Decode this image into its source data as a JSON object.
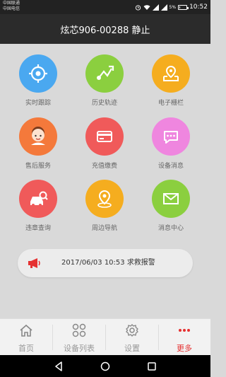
{
  "status_bar": {
    "carrier1": "中国联通",
    "carrier2": "中国电信",
    "battery_percent": "5%",
    "battery_level": 0.05,
    "time": "10:52"
  },
  "header": {
    "title": "炫芯906-00288 静止"
  },
  "tiles": [
    {
      "label": "实时跟踪",
      "icon": "realtime-tracking-icon",
      "color": "#4aa8f0"
    },
    {
      "label": "历史轨迹",
      "icon": "history-track-icon",
      "color": "#8bcf3f"
    },
    {
      "label": "电子栅栏",
      "icon": "geofence-icon",
      "color": "#f5ad1f"
    },
    {
      "label": "售后服务",
      "icon": "customer-service-icon",
      "color": "#f4793b"
    },
    {
      "label": "充值缴费",
      "icon": "recharge-card-icon",
      "color": "#f05a5a"
    },
    {
      "label": "设备消息",
      "icon": "chat-bubble-icon",
      "color": "#ef86df"
    },
    {
      "label": "违章查询",
      "icon": "violation-search-icon",
      "color": "#f05a5a"
    },
    {
      "label": "周边导航",
      "icon": "location-pin-icon",
      "color": "#f5ad1f"
    },
    {
      "label": "消息中心",
      "icon": "mail-icon",
      "color": "#8bcf3f"
    }
  ],
  "alert": {
    "text": "2017/06/03 10:53 求救报警",
    "icon": "megaphone-icon",
    "color": "#e53030"
  },
  "bottom_nav": [
    {
      "label": "首页",
      "icon": "home-icon",
      "active": false
    },
    {
      "label": "设备列表",
      "icon": "device-list-icon",
      "active": false
    },
    {
      "label": "设置",
      "icon": "gear-icon",
      "active": false
    },
    {
      "label": "更多",
      "icon": "more-dots-icon",
      "active": true
    }
  ],
  "system_nav": [
    {
      "icon": "back-triangle-icon"
    },
    {
      "icon": "home-circle-icon"
    },
    {
      "icon": "recents-square-icon"
    }
  ]
}
